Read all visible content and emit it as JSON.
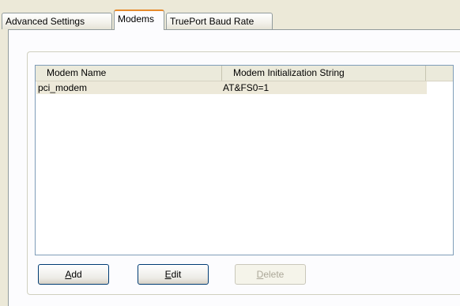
{
  "tabs": [
    {
      "label": "Advanced Settings",
      "selected": false
    },
    {
      "label": "Modems",
      "selected": true
    },
    {
      "label": "TruePort Baud Rate",
      "selected": false
    }
  ],
  "modem_list": {
    "columns": [
      "Modem Name",
      "Modem Initialization String"
    ],
    "rows": [
      {
        "name": "pci_modem",
        "init_string": "AT&FS0=1"
      }
    ]
  },
  "buttons": {
    "add": {
      "label": "Add",
      "enabled": true
    },
    "edit": {
      "label": "Edit",
      "enabled": true
    },
    "delete": {
      "label": "Delete",
      "enabled": false
    }
  },
  "colors": {
    "dialog_background": "#ECE9D8",
    "tab_page_background": "#FCFCFE",
    "selected_tab_accent": "#E68B2C",
    "selected_row": "#EDE9D9",
    "list_border": "#7F9DB9",
    "disabled_text": "#ACA899"
  }
}
